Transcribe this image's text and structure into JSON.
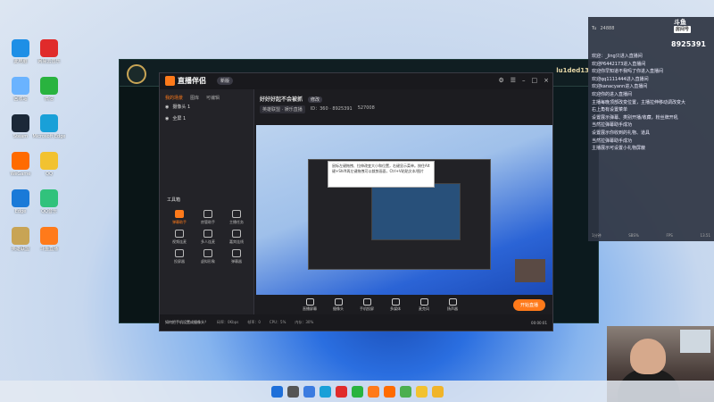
{
  "desktop": {
    "icons": [
      {
        "label": "此电脑",
        "icon": "pc-icon",
        "color": "#1e8fe6"
      },
      {
        "label": "网易云音乐",
        "icon": "music-icon",
        "color": "#e02b2b"
      },
      {
        "label": "回收站",
        "icon": "recycle-bin-icon",
        "color": "#6ab3ff"
      },
      {
        "label": "微信",
        "icon": "wechat-icon",
        "color": "#29b33f"
      },
      {
        "label": "Steam",
        "icon": "steam-icon",
        "color": "#1b2838"
      },
      {
        "label": "Microsoft Edge",
        "icon": "edge-icon",
        "color": "#19a0d8"
      },
      {
        "label": "WeGame",
        "icon": "wegame-icon",
        "color": "#ff6b00"
      },
      {
        "label": "QQ",
        "icon": "qq-icon",
        "color": "#f2c230"
      },
      {
        "label": "Edge",
        "icon": "ie-icon",
        "color": "#1a7ad8"
      },
      {
        "label": "QQ音乐",
        "icon": "qqmusic-icon",
        "color": "#31c27c"
      },
      {
        "label": "英雄联盟",
        "icon": "lol-icon",
        "color": "#c8a455"
      },
      {
        "label": "斗鱼直播",
        "icon": "douyu-icon",
        "color": "#ff7a1a"
      }
    ]
  },
  "game_client": {
    "username": "lu1ded13"
  },
  "stream_app": {
    "brand": "直播伴侣",
    "version": "新版",
    "tabs": [
      "我的场景",
      "图库",
      "可编辑"
    ],
    "scenes": [
      {
        "name": "摄像头 1"
      },
      {
        "name": "全屏 1"
      }
    ],
    "tools_title": "工具箱",
    "tools": [
      "弹幕助手",
      "房管助手",
      "主播任务",
      "视频连麦",
      "多人连麦",
      "嘉宾连线",
      "投屏器",
      "虚拟形象",
      "弹幕器"
    ],
    "stream_title": "好好好起不会被抓",
    "edit_label": "修改",
    "category": "英雄联盟 · 娱乐直播",
    "room_label": "ID：360 · 8925391",
    "viewer_count": "527008",
    "tooltip_text": "鼠标左键拖拽、拉伸改变大小和位置，右键显示菜单。按住Alt键+Shift再左键拖拽可以裁剪画面，Ctrl+V粘贴文本/图片",
    "bottom_buttons": [
      "直播屏幕",
      "摄像头",
      "手机投屏",
      "多媒体",
      "麦克风",
      "扬声器"
    ],
    "start_button": "开始直播",
    "status_notice": "如何把手机设置成摄像头？",
    "status_items": [
      "码率：0Kbps",
      "帧率：0",
      "CPU：5%",
      "内存：30%"
    ],
    "live_time": "00:00:01"
  },
  "overlay": {
    "logo": "斗鱼",
    "room_label": "房间号",
    "room_id": "8925391",
    "top_items": [
      "Tu",
      "24888"
    ],
    "messages": [
      "欢迎：_Jing只进入直播间",
      "欢迎P6442173进入直播间",
      "欢迎你早知道不我吗了你进入直播间",
      "欢迎qq1111444进入直播间",
      "欢迎kanacyann进入直播间",
      "欢迎你的进入直播间",
      "主播每晚顶部改变位置，主播拉伸移动调改变大",
      "",
      "右上角有设置菜单",
      "设置展示弹幕、类别开播/收藏，粉丝牌开吼",
      "",
      "当然拉弹幕助手成功",
      "设置展示你收到的礼物、道具",
      "当然拉弹幕助手成功",
      "主播展示可设置小礼物屏蔽"
    ],
    "bottom_items": [
      "1分钟",
      "SBS%",
      "FPS",
      "13.51"
    ]
  },
  "taskbar": {
    "apps": [
      "windows-start-icon",
      "search-icon",
      "task-view-icon",
      "edge-icon",
      "netease-icon",
      "wechat-icon",
      "douyu-icon",
      "wegame-icon",
      "chrome-icon",
      "qq-icon",
      "explorer-icon"
    ]
  }
}
